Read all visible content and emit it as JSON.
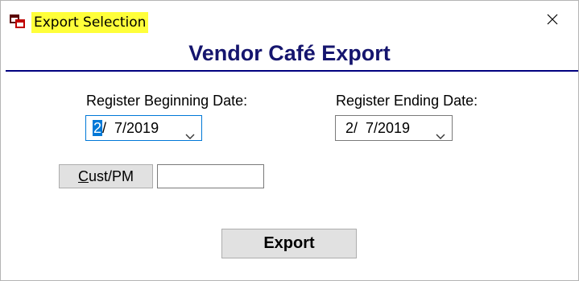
{
  "window": {
    "title": "Export Selection",
    "close_icon": "close-icon",
    "app_icon": "app-windows-icon"
  },
  "heading": "Vendor Café Export",
  "begin_date": {
    "label": "Register Beginning Date:",
    "month": "2",
    "rest": "/  7/2019",
    "chevron_icon": "chevron-down-icon"
  },
  "end_date": {
    "label": "Register Ending Date:",
    "value": "2/  7/2019",
    "chevron_icon": "chevron-down-icon"
  },
  "cust_pm": {
    "button_mnemonic": "C",
    "button_rest": "ust/PM",
    "input_value": ""
  },
  "export_button": "Export",
  "colors": {
    "title_highlight": "#ffff3a",
    "heading": "#15156e",
    "rule": "#00007f",
    "focus": "#0078d7"
  }
}
